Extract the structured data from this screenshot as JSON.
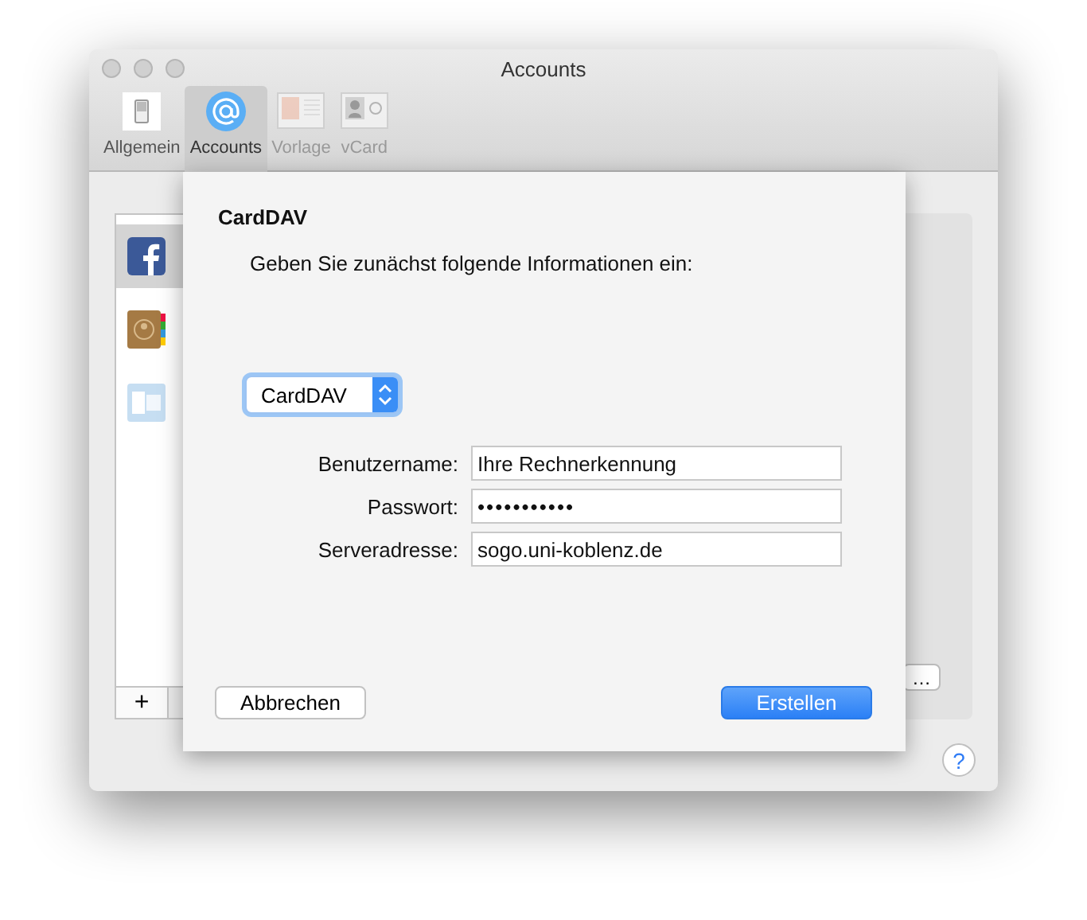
{
  "window": {
    "title": "Accounts"
  },
  "toolbar": [
    {
      "label": "Allgemein",
      "kind": "general",
      "selected": false,
      "disabled": false
    },
    {
      "label": "Accounts",
      "kind": "at",
      "selected": true,
      "disabled": false
    },
    {
      "label": "Vorlage",
      "kind": "template",
      "selected": false,
      "disabled": true
    },
    {
      "label": "vCard",
      "kind": "vcard",
      "selected": false,
      "disabled": true
    }
  ],
  "accounts": [
    {
      "kind": "facebook",
      "selected": true,
      "disabled": false
    },
    {
      "kind": "contacts",
      "selected": false,
      "disabled": false
    },
    {
      "kind": "exchange",
      "selected": false,
      "disabled": true
    }
  ],
  "list_buttons": [
    "+"
  ],
  "panel_button": "…",
  "help_button": "?",
  "sheet": {
    "title": "CardDAV",
    "instruction": "Geben Sie zunächst folgende Informationen ein:",
    "account_type": "CardDAV",
    "fields": [
      {
        "label": "Benutzername:",
        "value": "Ihre Rechnerkennung",
        "kind": "text"
      },
      {
        "label": "Passwort:",
        "value": "•••••••••••",
        "kind": "password"
      },
      {
        "label": "Serveradresse:",
        "value": "sogo.uni-koblenz.de",
        "kind": "text"
      }
    ],
    "cancel": "Abbrechen",
    "create": "Erstellen"
  }
}
